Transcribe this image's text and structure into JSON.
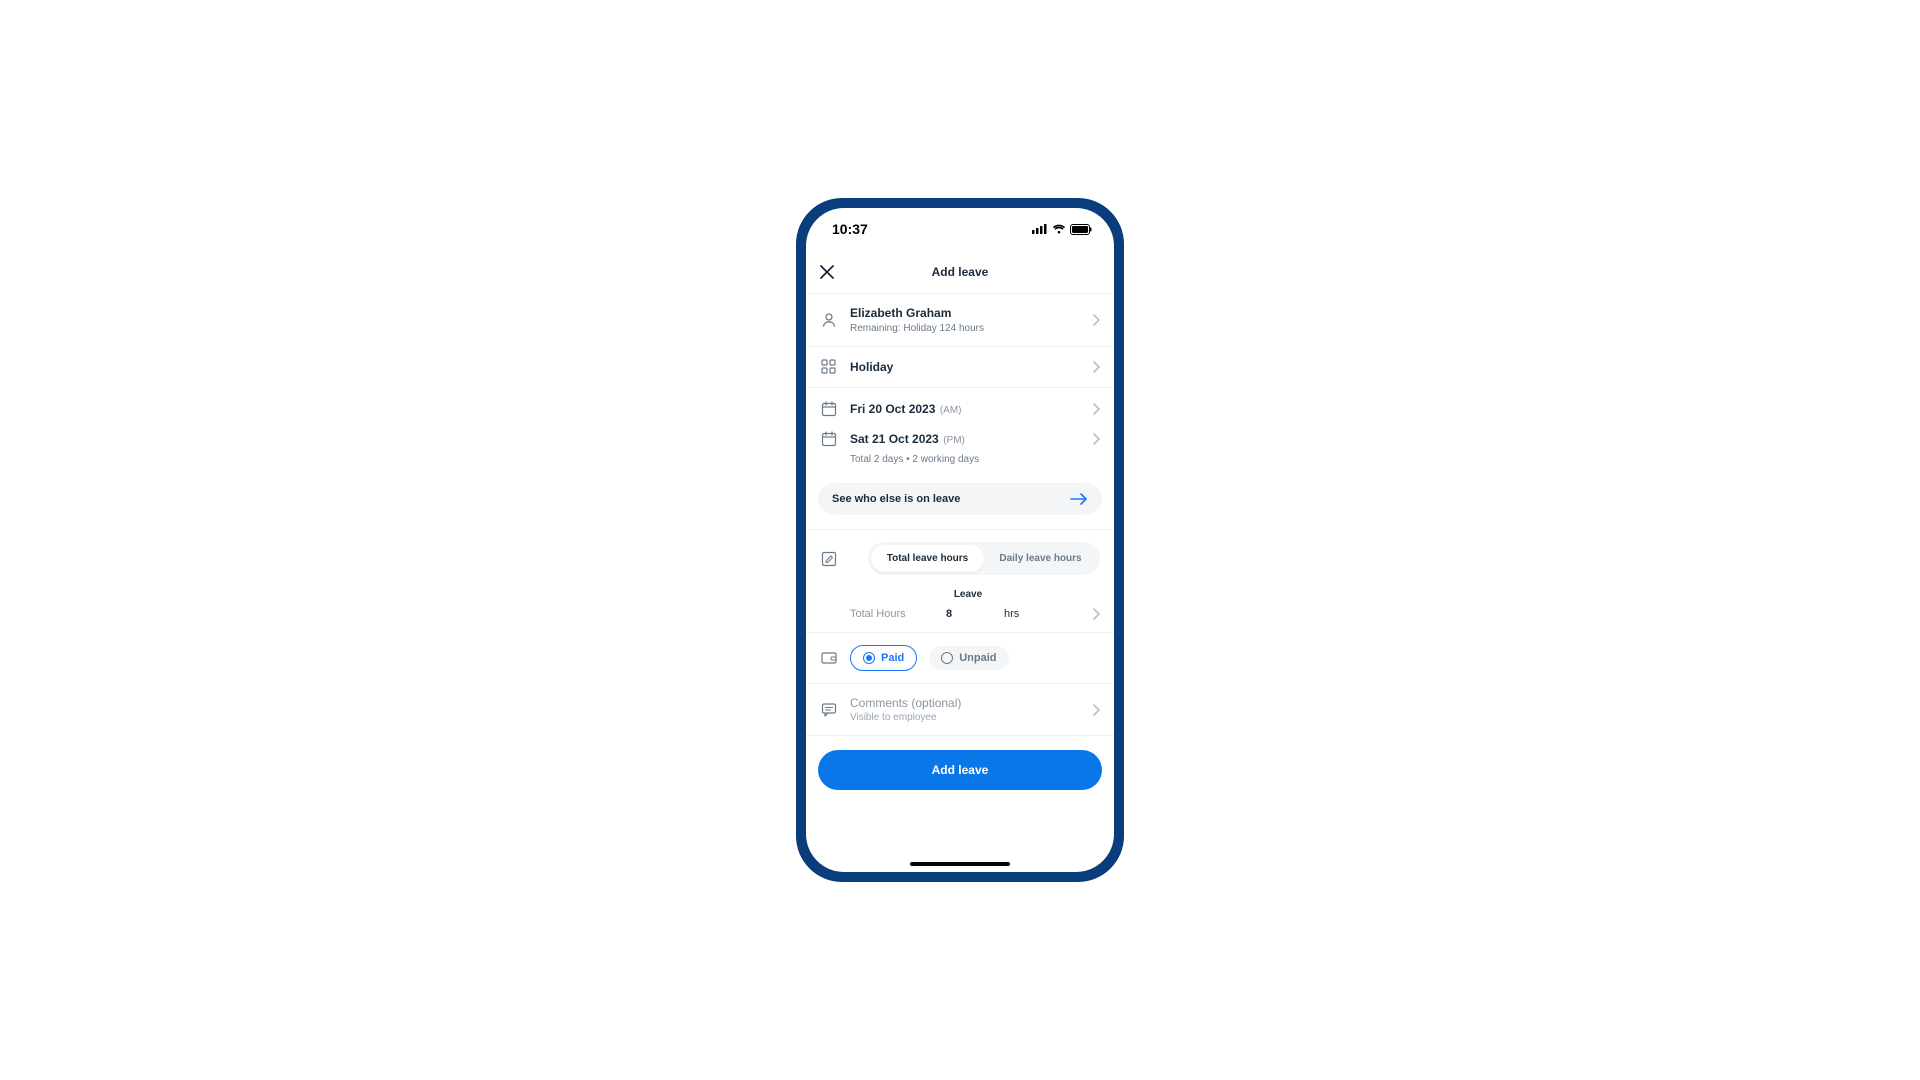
{
  "status": {
    "time": "10:37"
  },
  "nav": {
    "title": "Add leave"
  },
  "employee": {
    "name": "Elizabeth Graham",
    "remaining": "Remaining: Holiday 124 hours"
  },
  "type": {
    "label": "Holiday"
  },
  "dates": {
    "start": "Fri 20 Oct 2023",
    "start_meta": "(AM)",
    "end": "Sat 21 Oct 2023",
    "end_meta": "(PM)",
    "summary": "Total 2 days  •  2 working days"
  },
  "who_else": {
    "label": "See who else is on leave"
  },
  "hours": {
    "tab_total": "Total leave hours",
    "tab_daily": "Daily leave hours",
    "heading": "Leave",
    "row_label": "Total Hours",
    "value": "8",
    "unit": "hrs"
  },
  "pay": {
    "paid_label": "Paid",
    "unpaid_label": "Unpaid"
  },
  "comments": {
    "title": "Comments (optional)",
    "sub": "Visible to employee"
  },
  "footer": {
    "submit": "Add leave"
  }
}
